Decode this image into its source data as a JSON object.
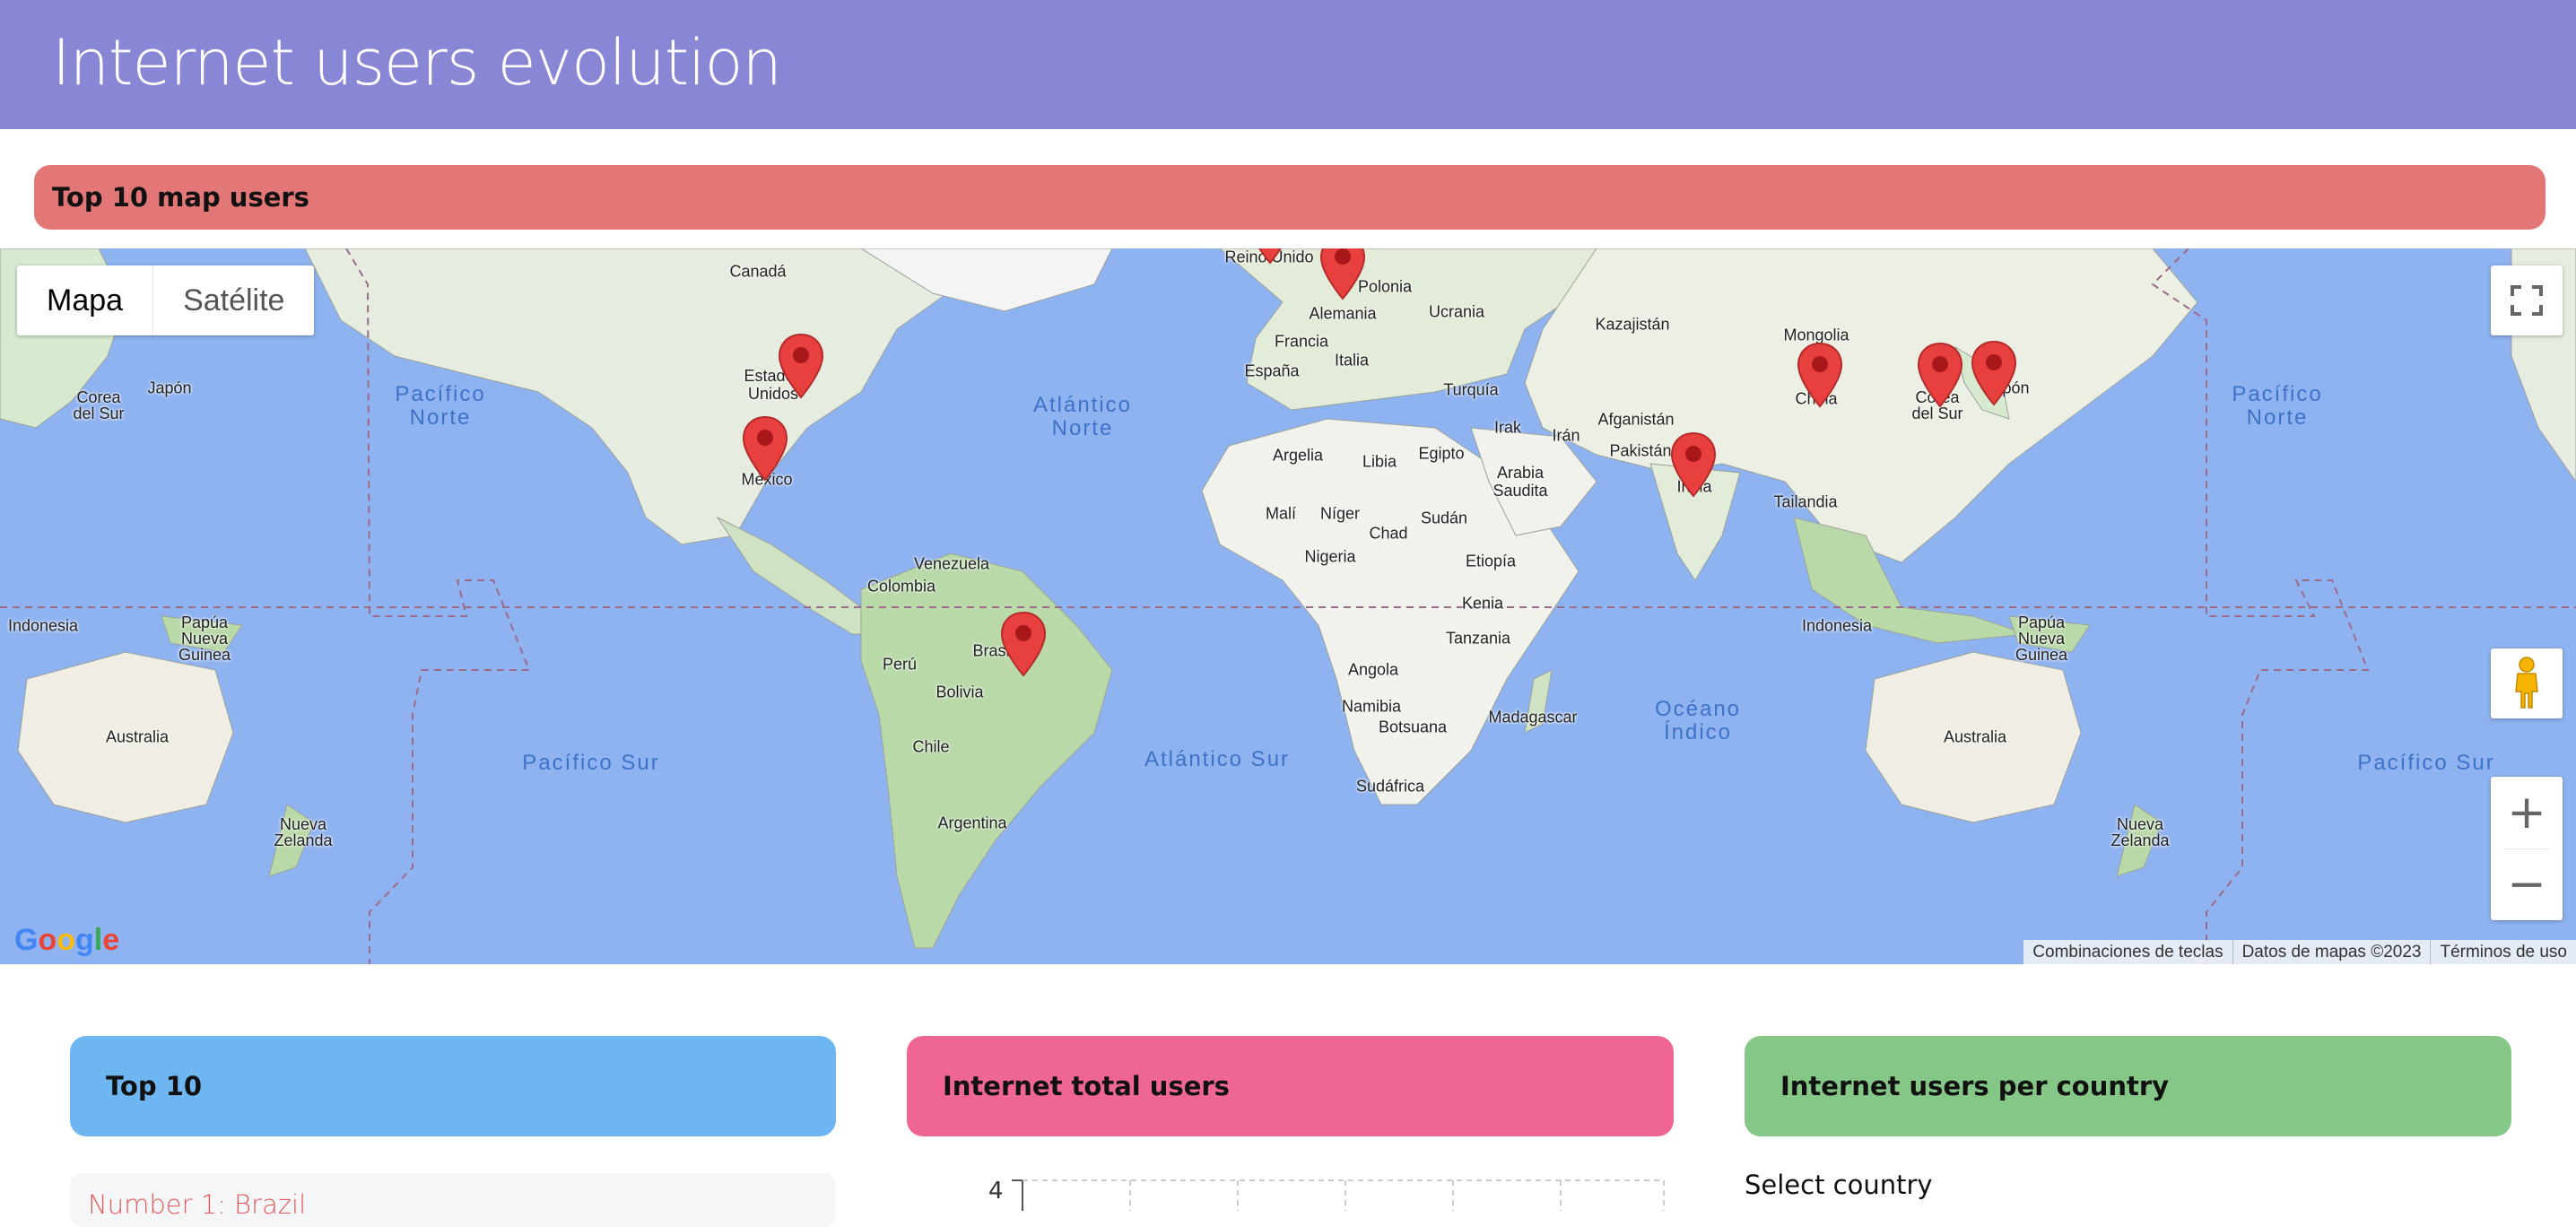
{
  "header": {
    "title": "Internet users evolution"
  },
  "map_section": {
    "title": "Top 10 map users",
    "map_type": {
      "map": "Mapa",
      "satellite": "Satélite"
    },
    "country_labels": [
      {
        "id": "canada",
        "text": "Canadá"
      },
      {
        "id": "reino-unido",
        "text": "Reino Unido"
      },
      {
        "id": "polonia",
        "text": "Polonia"
      },
      {
        "id": "alemania",
        "text": "Alemania"
      },
      {
        "id": "ucrania",
        "text": "Ucrania"
      },
      {
        "id": "francia",
        "text": "Francia"
      },
      {
        "id": "italia",
        "text": "Italia"
      },
      {
        "id": "espana",
        "text": "España"
      },
      {
        "id": "turquia",
        "text": "Turquía"
      },
      {
        "id": "kazajistan",
        "text": "Kazajistán"
      },
      {
        "id": "mongolia",
        "text": "Mongolia"
      },
      {
        "id": "china",
        "text": "China"
      },
      {
        "id": "corea-sur-e",
        "text": "Corea del Sur"
      },
      {
        "id": "japon-e",
        "text": "Japón"
      },
      {
        "id": "corea-sur-w",
        "text": "Corea del Sur"
      },
      {
        "id": "japon-w",
        "text": "Japón"
      },
      {
        "id": "estados-unidos",
        "text": "Estados Unidos"
      },
      {
        "id": "mexico",
        "text": "México"
      },
      {
        "id": "argelia",
        "text": "Argelia"
      },
      {
        "id": "libia",
        "text": "Libia"
      },
      {
        "id": "egipto",
        "text": "Egipto"
      },
      {
        "id": "irak",
        "text": "Irak"
      },
      {
        "id": "iran",
        "text": "Irán"
      },
      {
        "id": "afganistan",
        "text": "Afganistán"
      },
      {
        "id": "pakistan",
        "text": "Pakistán"
      },
      {
        "id": "arabia",
        "text": "Arabia Saudita"
      },
      {
        "id": "india",
        "text": "India"
      },
      {
        "id": "tailandia",
        "text": "Tailandia"
      },
      {
        "id": "mali",
        "text": "Malí"
      },
      {
        "id": "niger",
        "text": "Níger"
      },
      {
        "id": "chad",
        "text": "Chad"
      },
      {
        "id": "sudan",
        "text": "Sudán"
      },
      {
        "id": "nigeria",
        "text": "Nigeria"
      },
      {
        "id": "etiopia",
        "text": "Etiopía"
      },
      {
        "id": "kenia",
        "text": "Kenia"
      },
      {
        "id": "tanzania",
        "text": "Tanzania"
      },
      {
        "id": "angola",
        "text": "Angola"
      },
      {
        "id": "namibia",
        "text": "Namibia"
      },
      {
        "id": "botsuana",
        "text": "Botsuana"
      },
      {
        "id": "sudafrica",
        "text": "Sudáfrica"
      },
      {
        "id": "madagascar",
        "text": "Madagascar"
      },
      {
        "id": "venezuela",
        "text": "Venezuela"
      },
      {
        "id": "colombia",
        "text": "Colombia"
      },
      {
        "id": "peru",
        "text": "Perú"
      },
      {
        "id": "brasil",
        "text": "Brasil"
      },
      {
        "id": "bolivia",
        "text": "Bolivia"
      },
      {
        "id": "chile",
        "text": "Chile"
      },
      {
        "id": "argentina",
        "text": "Argentina"
      },
      {
        "id": "indonesia-w",
        "text": "Indonesia"
      },
      {
        "id": "indonesia-e",
        "text": "Indonesia"
      },
      {
        "id": "png-w",
        "text": "Papúa Nueva Guinea"
      },
      {
        "id": "png-e",
        "text": "Papúa Nueva Guinea"
      },
      {
        "id": "australia-w",
        "text": "Australia"
      },
      {
        "id": "australia-e",
        "text": "Australia"
      },
      {
        "id": "nz-w",
        "text": "Nueva Zelanda"
      },
      {
        "id": "nz-e",
        "text": "Nueva Zelanda"
      }
    ],
    "ocean_labels": [
      {
        "id": "pacifico-norte-w",
        "text": "Pacífico\nNorte"
      },
      {
        "id": "atlantico-norte",
        "text": "Atlántico\nNorte"
      },
      {
        "id": "pacifico-norte-e",
        "text": "Pacífico\nNorte"
      },
      {
        "id": "pacifico-sur-w",
        "text": "Pacífico Sur"
      },
      {
        "id": "atlantico-sur",
        "text": "Atlántico Sur"
      },
      {
        "id": "oceano-indico",
        "text": "Océano\nÍndico"
      },
      {
        "id": "pacifico-sur-e",
        "text": "Pacífico Sur"
      }
    ],
    "markers": [
      "Reino Unido",
      "Alemania",
      "Estados Unidos",
      "México",
      "Brasil",
      "India",
      "China",
      "Corea del Sur",
      "Japón"
    ],
    "google_logo": "Google",
    "attribution": {
      "shortcuts": "Combinaciones de teclas",
      "data": "Datos de mapas ©2023",
      "terms": "Términos de uso"
    }
  },
  "cards": {
    "top10": {
      "title": "Top 10",
      "items": [
        "Number 1: Brazil"
      ]
    },
    "total": {
      "title": "Internet total users",
      "y_tick": "4"
    },
    "per_country": {
      "title": "Internet users per country",
      "select_label": "Select country"
    }
  },
  "colors": {
    "header": "#8a86d6",
    "map_bar": "#e37676",
    "top10_bar": "#6db6f2",
    "total_bar": "#ef6593",
    "country_bar": "#85c787",
    "water": "#8fb3f0",
    "land": "#e9efe0",
    "marker": "#e8403f"
  }
}
